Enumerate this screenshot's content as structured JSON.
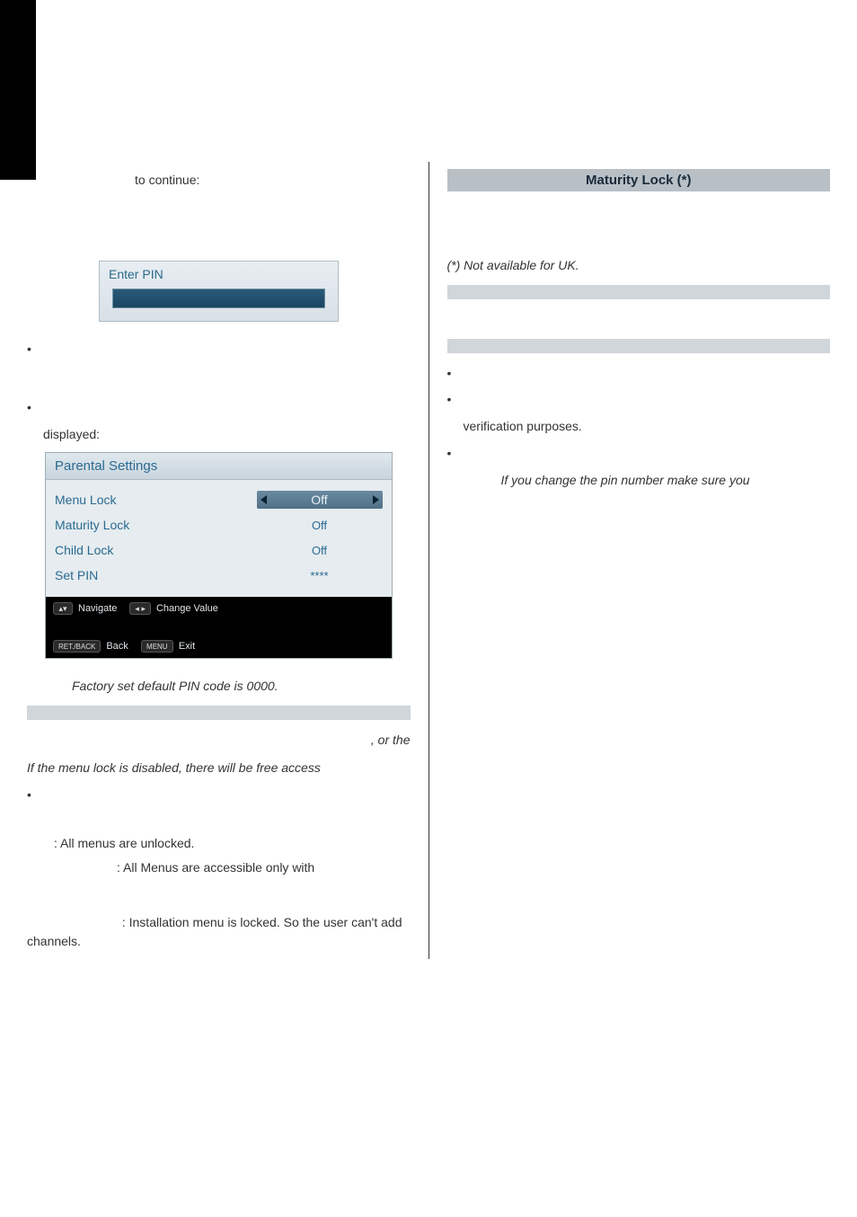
{
  "left": {
    "intro_tail": "to continue:",
    "enter_pin": {
      "title": "Enter PIN"
    },
    "bullets_top": [
      "",
      ""
    ],
    "displayed_label": "displayed:",
    "parental": {
      "title": "Parental Settings",
      "rows": [
        {
          "label": "Menu Lock",
          "value": "Off",
          "highlighted": true
        },
        {
          "label": "Maturity Lock",
          "value": "Off",
          "highlighted": false
        },
        {
          "label": "Child Lock",
          "value": "Off",
          "highlighted": false
        },
        {
          "label": "Set PIN",
          "value": "****",
          "highlighted": false
        }
      ],
      "footer": {
        "navigate": "Navigate",
        "change": "Change Value",
        "back": "Back",
        "exit": "Exit",
        "menu_key": "MENU",
        "return_key": "RET./BACK"
      }
    },
    "note_default_pin": "Factory set default PIN code is 0000.",
    "orthe": ", or the",
    "menu_lock_free": "If the menu lock is disabled, there will be free access",
    "all_unlocked": ": All menus are unlocked.",
    "all_accessible": ": All Menus are accessible only with",
    "install_locked": ": Installation menu is locked. So the user can't add channels."
  },
  "right": {
    "header": "Maturity Lock (*)",
    "not_available": "(*) Not available for UK.",
    "verification": "verification purposes.",
    "pin_warning": "If you change the pin number make sure you"
  }
}
